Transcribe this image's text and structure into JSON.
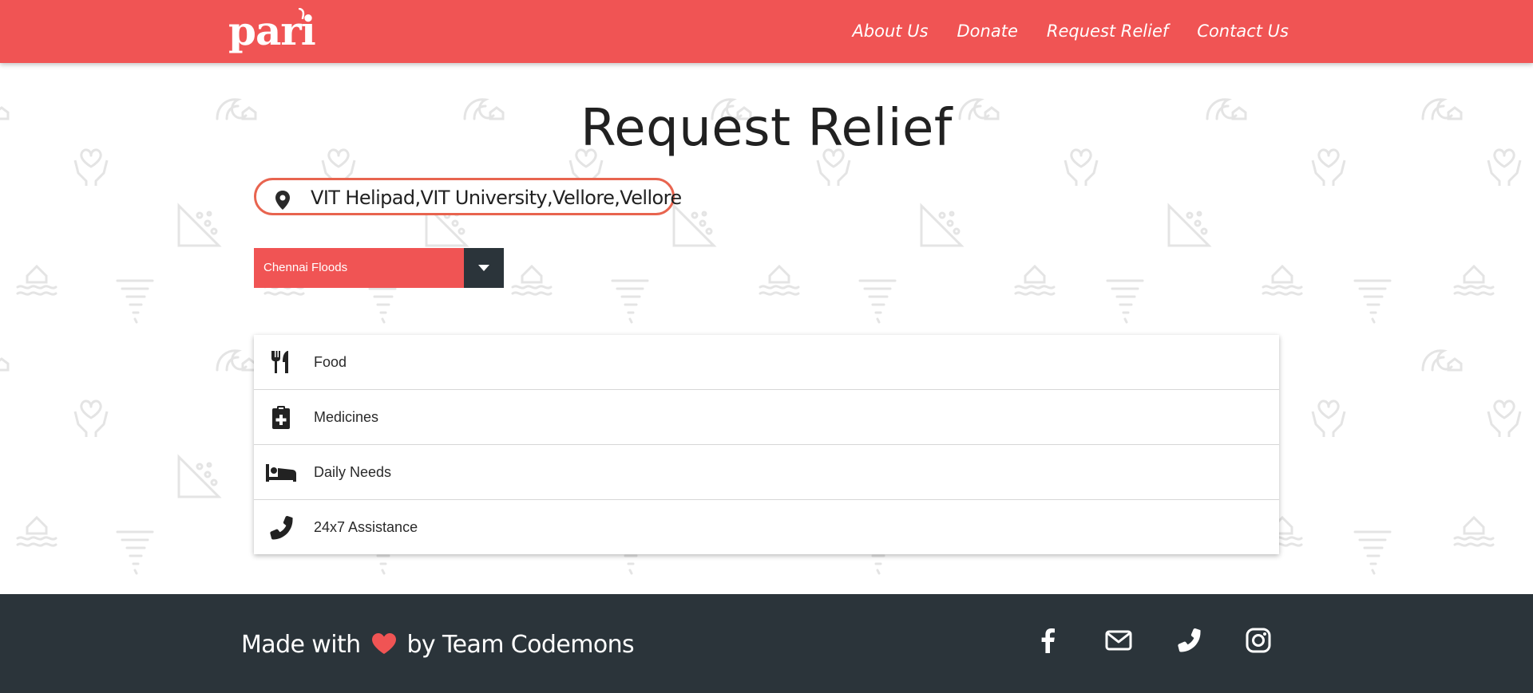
{
  "header": {
    "logo_text": "pari",
    "nav": [
      {
        "label": "About Us"
      },
      {
        "label": "Donate"
      },
      {
        "label": "Request Relief"
      },
      {
        "label": "Contact Us"
      }
    ]
  },
  "main": {
    "title": "Request Relief",
    "location": {
      "value": "VIT Helipad,VIT University,Vellore,Vellore",
      "icon": "map-pin-icon"
    },
    "disaster_select": {
      "selected": "Chennai Floods",
      "icon": "caret-down-icon"
    },
    "relief_options": [
      {
        "label": "Food",
        "icon": "utensils-icon"
      },
      {
        "label": "Medicines",
        "icon": "medical-clipboard-icon"
      },
      {
        "label": "Daily Needs",
        "icon": "bed-icon"
      },
      {
        "label": "24x7 Assistance",
        "icon": "phone-icon"
      }
    ]
  },
  "footer": {
    "text_before": "Made with",
    "text_after": "by Team Codemons",
    "social": [
      {
        "icon": "facebook-icon"
      },
      {
        "icon": "envelope-icon"
      },
      {
        "icon": "phone-icon"
      },
      {
        "icon": "instagram-icon"
      }
    ]
  },
  "colors": {
    "primary": "#f05454",
    "dark": "#2b343a",
    "pill_border": "#e8644f",
    "heart": "#f05454"
  }
}
